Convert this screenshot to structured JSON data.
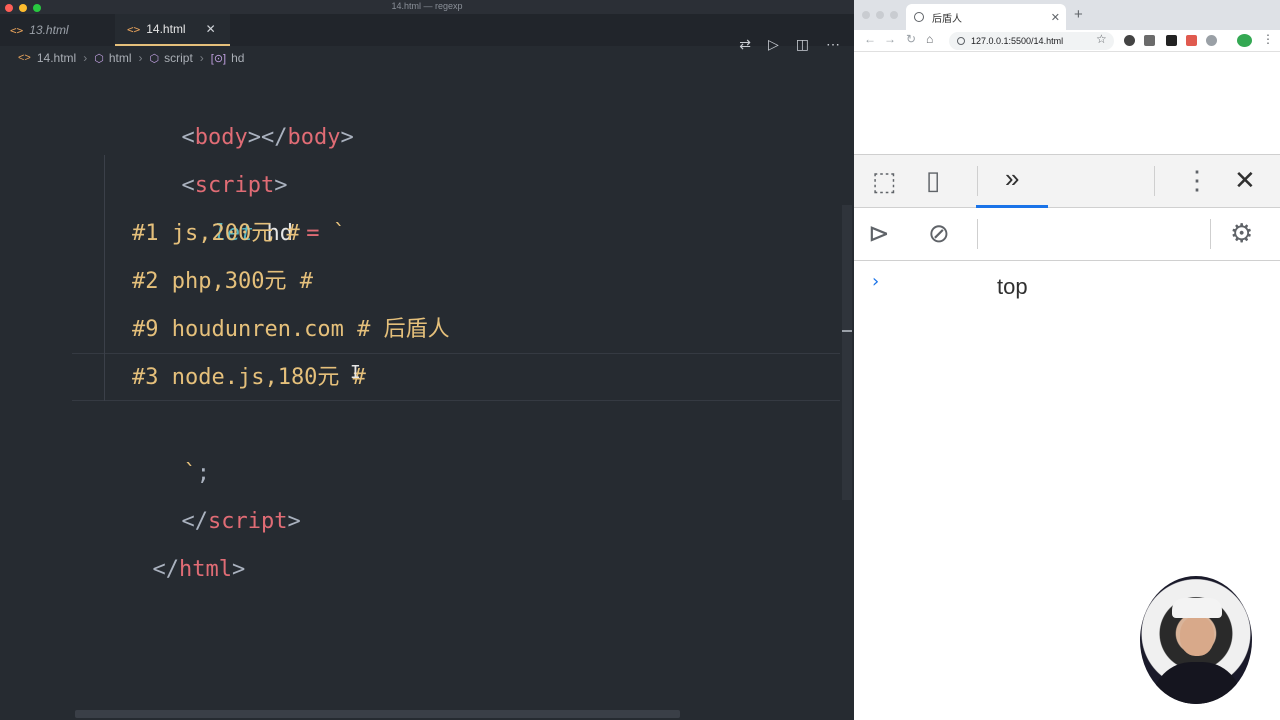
{
  "window": {
    "title": "14.html — regexp"
  },
  "editor": {
    "tabs": [
      {
        "label": "13.html",
        "active": false
      },
      {
        "label": "14.html",
        "active": true
      }
    ],
    "breadcrumb": [
      "14.html",
      "html",
      "script",
      "hd"
    ],
    "code_lines": {
      "l1": {
        "open": "<",
        "tag1": "body",
        "mid": "></",
        "tag2": "body",
        "close": ">"
      },
      "l2": {
        "open": "<",
        "tag": "script",
        "close": ">"
      },
      "l3": {
        "kw": "let",
        "ident": " hd ",
        "op": "=",
        "str": " `"
      },
      "l4": "#1 js,200元 #",
      "l5": "#2 php,300元 #",
      "l6": "#9 houdunren.com # 后盾人",
      "l7": "#3 node.js,180元 #",
      "l8": {
        "str": "`",
        "punc": ";"
      },
      "l9": {
        "open": "</",
        "tag": "script",
        "close": ">"
      },
      "l10": {
        "open": "</",
        "tag": "html",
        "close": ">"
      }
    },
    "icons": [
      "source-control-icon",
      "run-icon",
      "split-editor-icon",
      "more-icon"
    ]
  },
  "browser": {
    "tab_title": "后盾人",
    "url": "127.0.0.1:5500/14.html",
    "devtools": {
      "context": "top",
      "prompt": "›"
    }
  },
  "colors": {
    "tag": "#e06c75",
    "keyword": "#56b6c2",
    "string": "#e5c07b",
    "editor_bg": "#262b31",
    "devtools_active": "#1a73e8"
  }
}
